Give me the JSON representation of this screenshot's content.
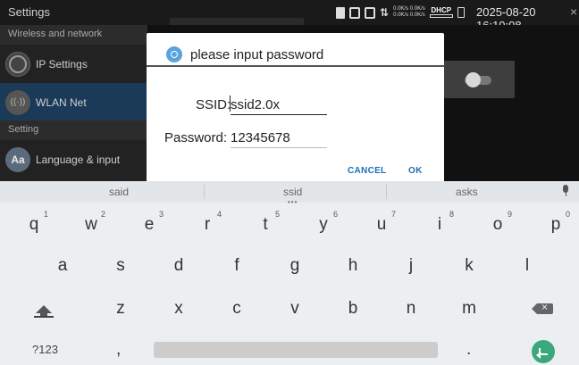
{
  "status_bar": {
    "app_title": "Settings",
    "net_speed_up": "0.0K/s 0.0K/s",
    "net_speed_down": "0.0K/s 0.0K/s",
    "dhcp_label": "DHCP",
    "datetime": "2025-08-20 16:10:08",
    "close_glyph": "×"
  },
  "settings": {
    "section_wireless": "Wireless and network",
    "items": [
      {
        "label": "IP Settings",
        "icon": "globe-icon"
      },
      {
        "label": "WLAN Net",
        "icon": "wifi-icon"
      }
    ],
    "section_setting": "Setting",
    "items2": [
      {
        "label": "Language & input",
        "icon": "language-icon",
        "icon_text": "Aa"
      }
    ]
  },
  "dialog": {
    "title": "please input password",
    "ssid_label": "SSID:",
    "ssid_value": "ssid2.0x",
    "password_label": "Password:",
    "password_value": "12345678",
    "cancel_label": "CANCEL",
    "ok_label": "OK",
    "button_color": "#1d6fb5"
  },
  "keyboard": {
    "suggestions": [
      "said",
      "ssid",
      "asks"
    ],
    "row1": [
      {
        "key": "q",
        "hint": "1"
      },
      {
        "key": "w",
        "hint": "2"
      },
      {
        "key": "e",
        "hint": "3"
      },
      {
        "key": "r",
        "hint": "4"
      },
      {
        "key": "t",
        "hint": "5"
      },
      {
        "key": "y",
        "hint": "6"
      },
      {
        "key": "u",
        "hint": "7"
      },
      {
        "key": "i",
        "hint": "8"
      },
      {
        "key": "o",
        "hint": "9"
      },
      {
        "key": "p",
        "hint": "0"
      }
    ],
    "row2": [
      "a",
      "s",
      "d",
      "f",
      "g",
      "h",
      "j",
      "k",
      "l"
    ],
    "row3": [
      "z",
      "x",
      "c",
      "v",
      "b",
      "n",
      "m"
    ],
    "symbols_label": "?123",
    "comma_label": ",",
    "period_label": ".",
    "enter_color": "#3aa87c"
  }
}
